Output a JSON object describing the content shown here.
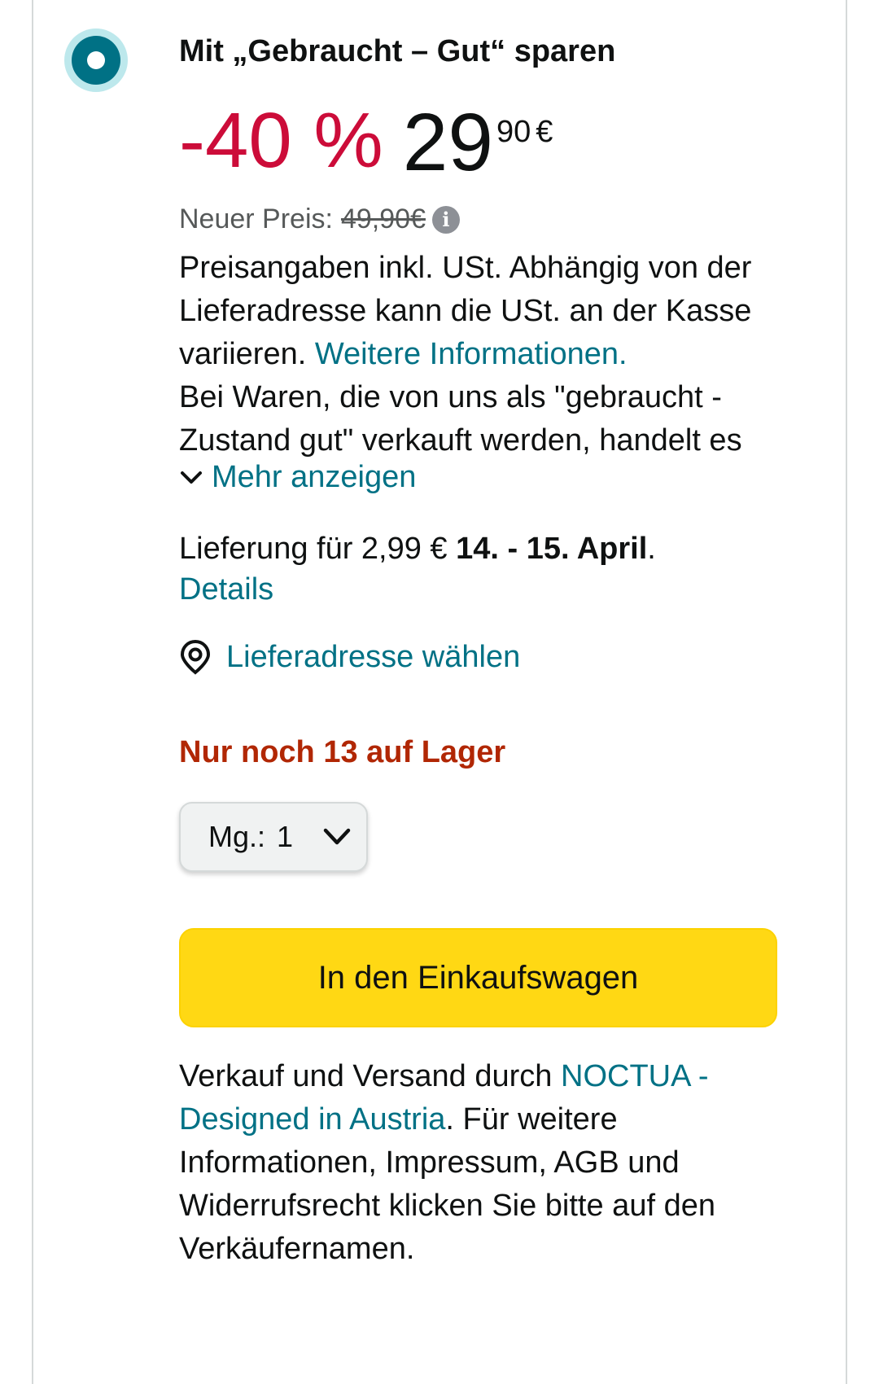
{
  "offer": {
    "title": "Mit „Gebraucht – Gut“ sparen",
    "discount": "-40 %",
    "price_whole": "29",
    "price_fraction": "90",
    "currency": "€",
    "list_price_label": "Neuer Preis:",
    "list_price": "49,90€",
    "selected": true
  },
  "tax_info": {
    "text": "Preisangaben inkl. USt. Abhängig von der Lieferadresse kann die USt. an der Kasse variieren.",
    "link": "Weitere Informationen.",
    "condition_text": "Bei Waren, die von uns als \"gebraucht - Zustand gut\" verkauft werden, handelt es",
    "show_more": "Mehr anzeigen"
  },
  "delivery": {
    "prefix": "Lieferung für 2,99 €",
    "dates": "14. - 15. April",
    "suffix": ".",
    "details_link": "Details",
    "address_link": "Lieferadresse wählen"
  },
  "stock": {
    "text": "Nur noch 13 auf Lager"
  },
  "quantity": {
    "label": "Mg.:",
    "value": "1"
  },
  "cart_button": {
    "label": "In den Einkaufswagen"
  },
  "seller": {
    "prefix": "Verkauf und Versand durch",
    "name": "NOCTUA - Designed in Austria",
    "suffix": ". Für weitere Informationen, Impressum, AGB und Widerrufsrecht klicken Sie bitte auf den Verkäufernamen."
  },
  "colors": {
    "discount": "#cc0c39",
    "link": "#007185",
    "stock": "#b12704",
    "cart_button": "#ffd814",
    "radio": "#007185"
  },
  "icons": [
    "radio-selected-icon",
    "info-icon",
    "chevron-down-icon",
    "location-pin-icon",
    "dropdown-chevron-icon"
  ]
}
